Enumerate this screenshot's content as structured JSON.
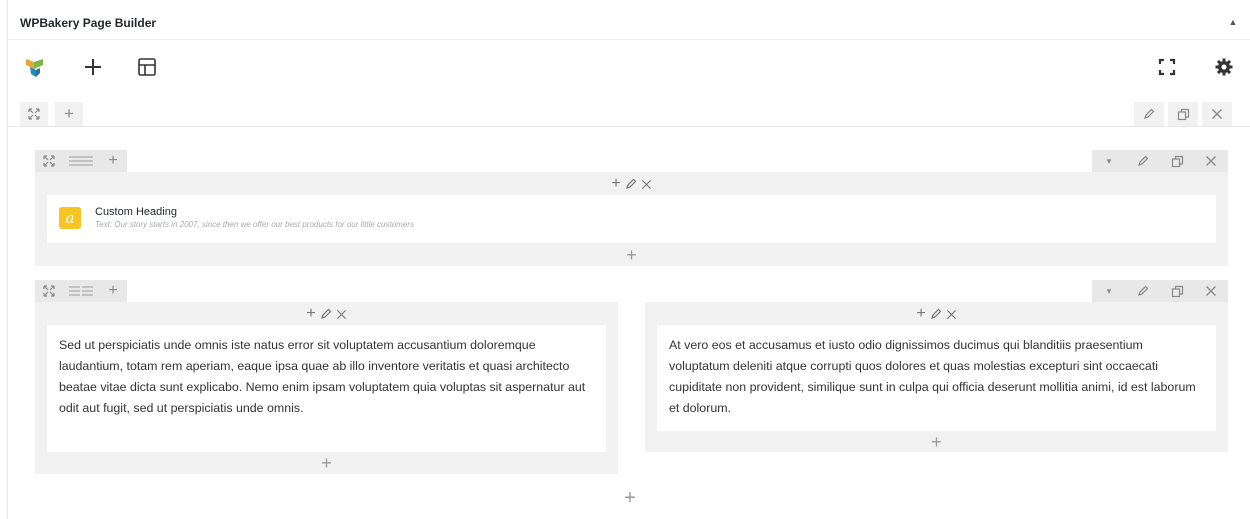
{
  "header": {
    "title": "WPBakery Page Builder",
    "toggle_icon": "triangle-up-icon"
  },
  "toolbar": {
    "left_icons": [
      "wpbakery-logo-icon",
      "add-element-icon",
      "templates-icon"
    ],
    "right_icons": [
      "fullscreen-icon",
      "settings-gear-icon"
    ]
  },
  "rows": [
    {
      "columns": [
        {
          "elements": [
            {
              "type": "custom-heading",
              "badge": "a",
              "name": "Custom Heading",
              "text": "Text: Our story starts in 2007, since then we offer our best products for our little customers"
            }
          ]
        }
      ]
    },
    {
      "columns": [
        {
          "text": "Sed ut perspiciatis unde omnis iste natus error sit voluptatem accusantium doloremque laudantium, totam rem aperiam, eaque ipsa quae ab illo inventore veritatis et quasi architecto beatae vitae dicta sunt explicabo. Nemo enim ipsam voluptatem quia voluptas sit aspernatur aut odit aut fugit, sed ut perspiciatis unde omnis."
        },
        {
          "text": "At vero eos et accusamus et iusto odio dignissimos ducimus qui blanditiis praesentium voluptatum deleniti atque corrupti quos dolores et quas molestias excepturi sint occaecati cupiditate non provident, similique sunt in culpa qui officia deserunt mollitia animi, id est laborum et dolorum."
        }
      ]
    }
  ],
  "colors": {
    "accent_yellow": "#f8c423",
    "control_bg": "#f1f1f1",
    "icon_gray": "#888888"
  }
}
